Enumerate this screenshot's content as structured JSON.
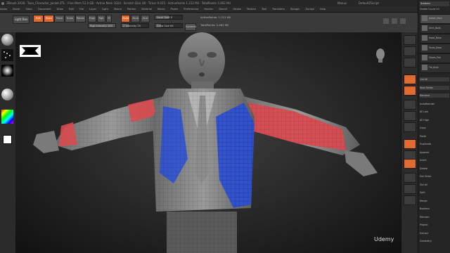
{
  "titlebar": {
    "title": "ZBrush 2018 · Toon_Character_Jacket.ZTL · Free Mem 51.0 GB · Active Mem 1024 · Scratch Disk 48 · Timer 0.025 · ActivePoints 1.212 Mil · TotalPoints 2.462 Mil",
    "menu_label": "Menus",
    "default_script": "DefaultZScript"
  },
  "menubar": {
    "items": [
      "Alpha",
      "Brush",
      "Color",
      "Document",
      "Draw",
      "Edit",
      "File",
      "Layer",
      "Light",
      "Macro",
      "Marker",
      "Material",
      "Movie",
      "Picker",
      "Preferences",
      "Render",
      "Stencil",
      "Stroke",
      "Texture",
      "Tool",
      "Transform",
      "Zplugin",
      "Zscript",
      "Help"
    ]
  },
  "topbar": {
    "home_label": "Light Box",
    "mrgb_label": "Mrgb",
    "rgb_label": "Rgb",
    "m_label": "M",
    "rgb_intensity_label": "Rgb Intensity 100",
    "zadd_label": "Zadd",
    "zsub_label": "Zsub",
    "zcut_label": "Zcut",
    "z_intensity_label": "Z Intensity 25",
    "focal_shift_label": "Focal Shift 0",
    "draw_size_label": "Draw Size 64",
    "dynamic_label": "Dynamic",
    "active_points_label": "ActivePoints: 1.212 Mil",
    "total_points_label": "TotalPoints: 2.462 Mil",
    "draw_tabs": [
      "Edit",
      "Draw",
      "Move",
      "Scale",
      "Rotate"
    ]
  },
  "right_panel": {
    "header": "Subtool",
    "visible_count": "Visible Count 20",
    "items": [
      "Jacket_Main",
      "Shirt_Body",
      "Head_Base",
      "Pants_Base",
      "Shoes_Pair",
      "Tie_Knot"
    ],
    "sections": [
      "List All",
      "New Folder",
      "Rename",
      "AutoReorder",
      "All Low",
      "All High",
      "Copy",
      "Paste",
      "Duplicate",
      "Append",
      "Insert",
      "Delete",
      "Del Other",
      "Del All",
      "Split",
      "Merge",
      "Boolean",
      "Remesh",
      "Project",
      "Extract",
      "Geometry"
    ]
  },
  "watermark": "Udemy",
  "colors": {
    "accent": "#e4692d",
    "polygroup_red": "#d94a4f",
    "polygroup_blue": "#2a4fd6"
  }
}
